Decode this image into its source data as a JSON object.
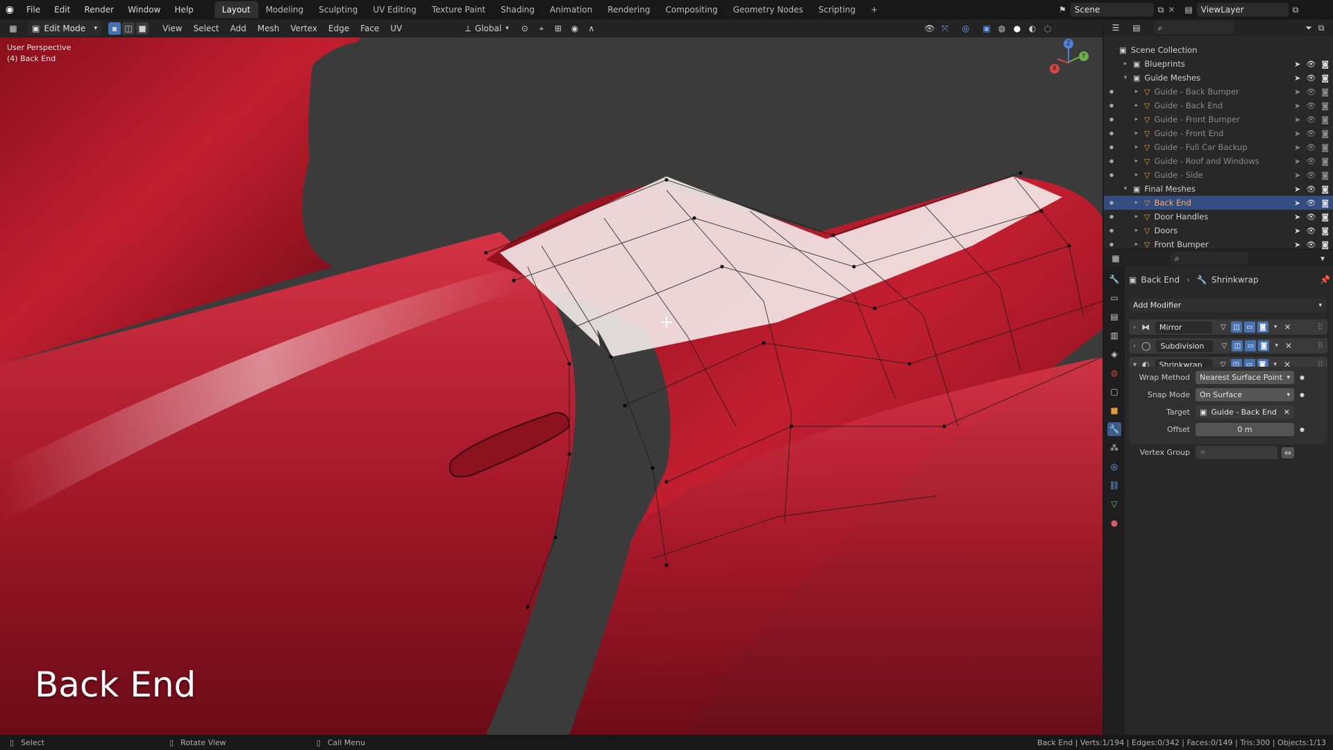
{
  "top_menu": [
    "File",
    "Edit",
    "Render",
    "Window",
    "Help"
  ],
  "workspaces": [
    "Layout",
    "Modeling",
    "Sculpting",
    "UV Editing",
    "Texture Paint",
    "Shading",
    "Animation",
    "Rendering",
    "Compositing",
    "Geometry Nodes",
    "Scripting"
  ],
  "active_workspace": "Layout",
  "add_workspace": "+",
  "scene_name": "Scene",
  "view_layer": "ViewLayer",
  "header": {
    "mode": "Edit Mode",
    "menus": [
      "View",
      "Select",
      "Add",
      "Mesh",
      "Vertex",
      "Edge",
      "Face",
      "UV"
    ],
    "orientation": "Global"
  },
  "viewport": {
    "perspective": "User Perspective",
    "object_info": "(4) Back End",
    "caption": "Back End",
    "axes": {
      "x": "X",
      "y": "Y",
      "z": "Z"
    }
  },
  "outliner": {
    "root": "Scene Collection",
    "rows": [
      {
        "label": "Blueprints",
        "kind": "collection",
        "depth": 1,
        "expanded": false
      },
      {
        "label": "Guide Meshes",
        "kind": "collection",
        "depth": 1,
        "expanded": true
      },
      {
        "label": "Guide - Back Bumper",
        "kind": "mesh",
        "depth": 2,
        "dim": true
      },
      {
        "label": "Guide - Back End",
        "kind": "mesh",
        "depth": 2,
        "dim": true
      },
      {
        "label": "Guide - Front Bumper",
        "kind": "mesh",
        "depth": 2,
        "dim": true
      },
      {
        "label": "Guide - Front End",
        "kind": "mesh",
        "depth": 2,
        "dim": true
      },
      {
        "label": "Guide - Full Car Backup",
        "kind": "mesh",
        "depth": 2,
        "dim": true
      },
      {
        "label": "Guide - Roof and Windows",
        "kind": "mesh",
        "depth": 2,
        "dim": true
      },
      {
        "label": "Guide - Side",
        "kind": "mesh",
        "depth": 2,
        "dim": true
      },
      {
        "label": "Final Meshes",
        "kind": "collection",
        "depth": 1,
        "expanded": true
      },
      {
        "label": "Back End",
        "kind": "mesh",
        "depth": 2,
        "selected": true
      },
      {
        "label": "Door Handles",
        "kind": "mesh",
        "depth": 2
      },
      {
        "label": "Doors",
        "kind": "mesh",
        "depth": 2
      },
      {
        "label": "Front Bumper",
        "kind": "mesh",
        "depth": 2
      }
    ]
  },
  "properties": {
    "breadcrumb_object": "Back End",
    "breadcrumb_modifier": "Shrinkwrap",
    "add_modifier": "Add Modifier",
    "modifiers": [
      {
        "name": "Mirror",
        "expanded": false
      },
      {
        "name": "Subdivision",
        "expanded": false
      },
      {
        "name": "Shrinkwrap",
        "expanded": true
      }
    ],
    "shrinkwrap": {
      "wrap_method_label": "Wrap Method",
      "wrap_method": "Nearest Surface Point",
      "snap_mode_label": "Snap Mode",
      "snap_mode": "On Surface",
      "target_label": "Target",
      "target": "Guide - Back End",
      "offset_label": "Offset",
      "offset": "0 m",
      "vertex_group_label": "Vertex Group",
      "vertex_group": ""
    }
  },
  "status": {
    "left": "Select",
    "middle": "Rotate View",
    "right": "Call Menu",
    "stats": "Back End | Verts:1/194 | Edges:0/342 | Faces:0/149 | Tris:300 | Objects:1/13"
  },
  "colors": {
    "car_red": "#b01a28",
    "selection_blue": "#334d80",
    "mesh_orange": "#e09a3a",
    "modifier_blue": "#4772b3"
  }
}
